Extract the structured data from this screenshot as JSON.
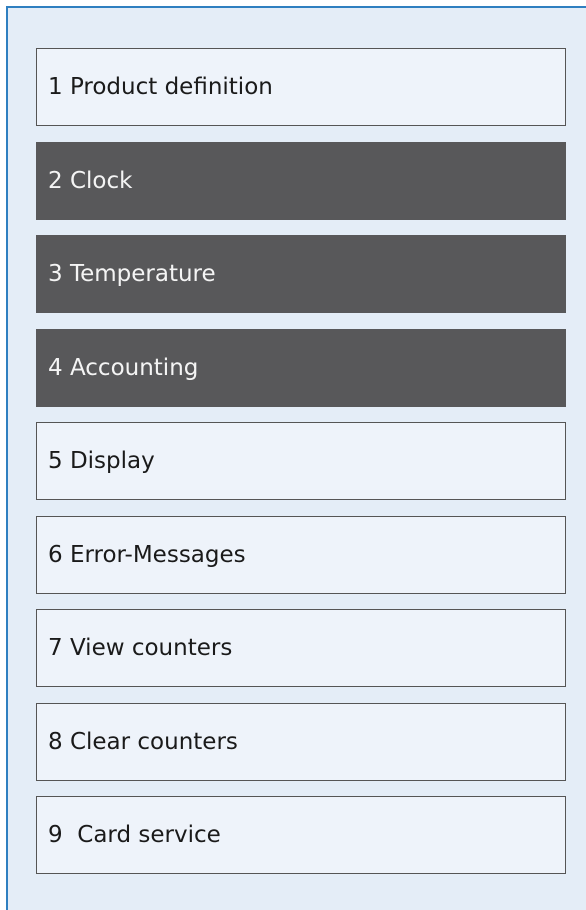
{
  "menu": {
    "items": [
      {
        "label": "1 Product definition",
        "state": "normal"
      },
      {
        "label": "2 Clock",
        "state": "active"
      },
      {
        "label": "3 Temperature",
        "state": "active"
      },
      {
        "label": "4 Accounting",
        "state": "active"
      },
      {
        "label": "5 Display",
        "state": "normal"
      },
      {
        "label": "6 Error-Messages",
        "state": "normal"
      },
      {
        "label": "7 View counters",
        "state": "normal"
      },
      {
        "label": "8 Clear counters",
        "state": "normal"
      },
      {
        "label": "9  Card service",
        "state": "normal"
      }
    ]
  },
  "colors": {
    "panel_background": "#e4edf7",
    "panel_border": "#2f7fc0",
    "item_background": "#eef3fa",
    "item_border": "#555555",
    "active_background": "#58585a",
    "active_text": "#f4f4f4"
  }
}
